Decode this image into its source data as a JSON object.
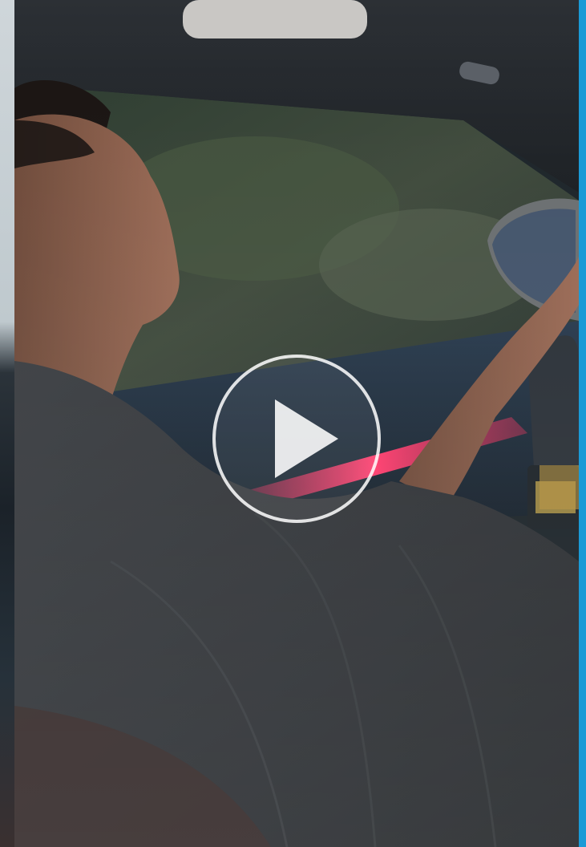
{
  "video": {
    "state": "paused",
    "play_icon": "play-icon",
    "accent_color": "#1a9ad6",
    "ambient_light_color": "#e0305a"
  }
}
